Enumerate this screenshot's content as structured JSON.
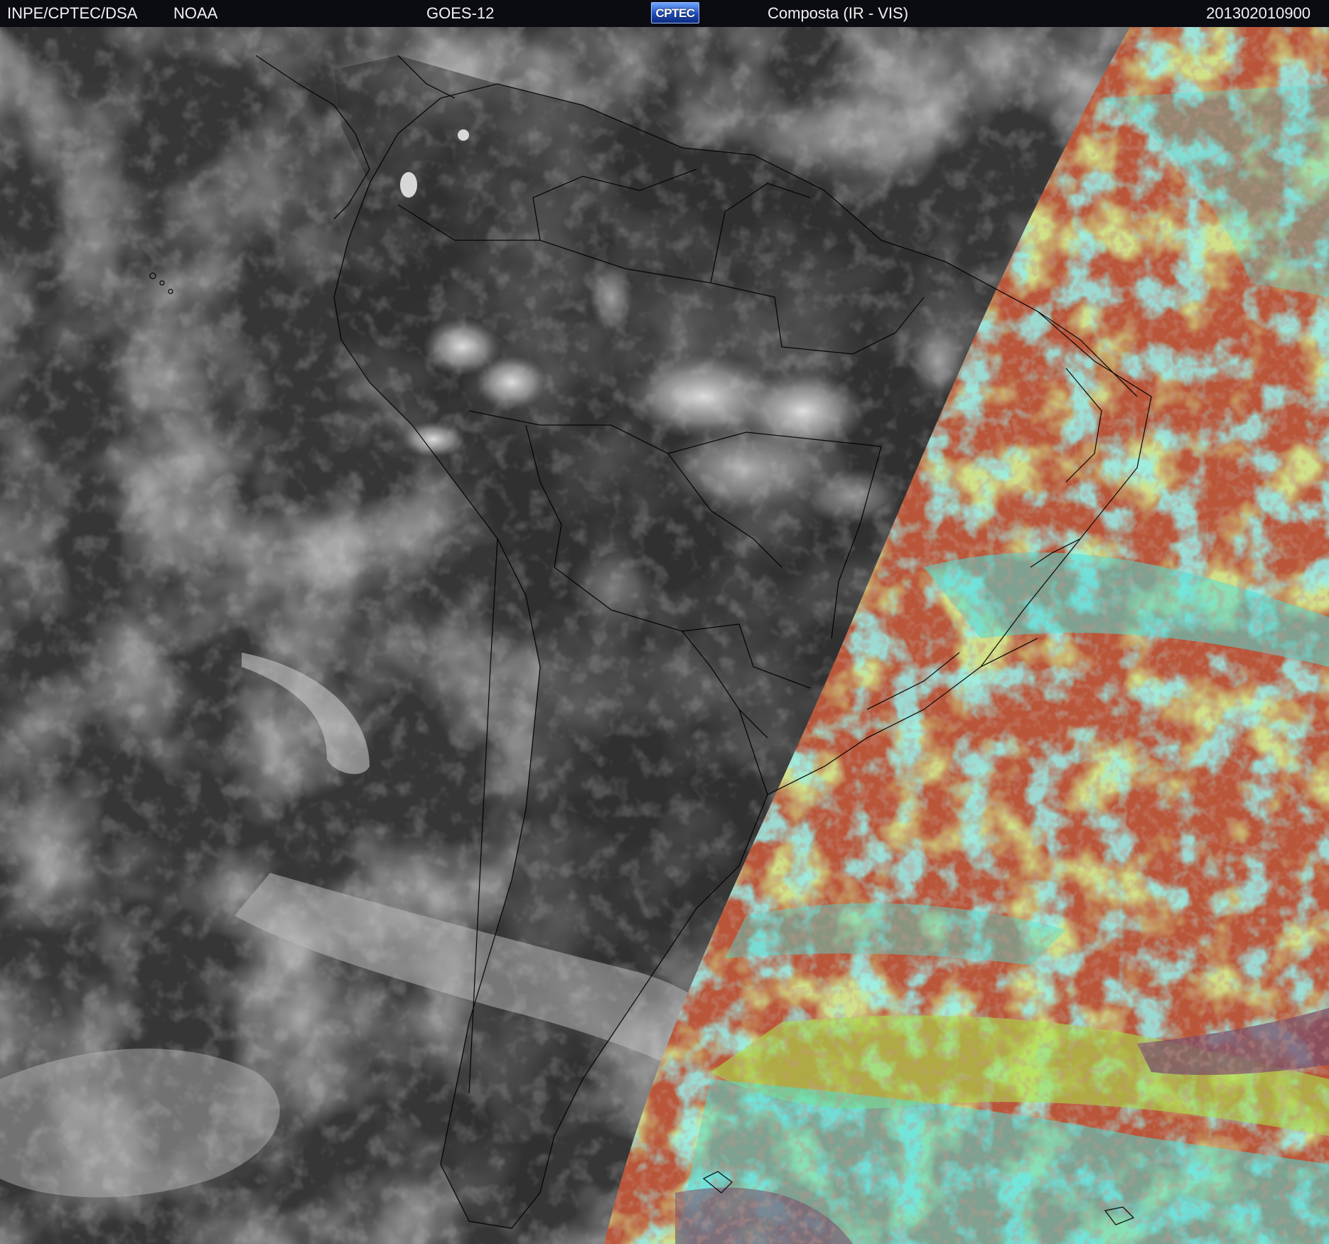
{
  "header": {
    "agency": "INPE/CPTEC/DSA",
    "source": "NOAA",
    "satellite": "GOES-12",
    "logo_text": "CPTEC",
    "product": "Composta (IR - VIS)",
    "timestamp": "201302010900"
  },
  "colors": {
    "header_bg": "#0b0b12",
    "ir_ocean": "#353535",
    "ir_cloud": "#cfcfcf",
    "vis_red": "#b9563a",
    "vis_cyan": "#4fe0d8",
    "vis_green": "#a8e24a",
    "vis_purple": "#7a4e6a",
    "border_line": "#000000"
  },
  "icons": {
    "logo": "cptec-logo-icon"
  }
}
